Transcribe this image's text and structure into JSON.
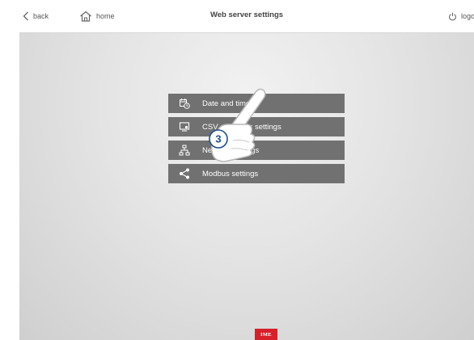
{
  "header": {
    "back_label": "back",
    "home_label": "home",
    "title": "Web server settings",
    "logout_label": "logo"
  },
  "menu": {
    "items": [
      {
        "label": "Date and time",
        "icon": "calendar-clock-icon"
      },
      {
        "label": "CSV and other settings",
        "icon": "monitor-settings-icon"
      },
      {
        "label": "Network settings",
        "icon": "network-icon"
      },
      {
        "label": "Modbus settings",
        "icon": "share-icon"
      }
    ]
  },
  "annotation": {
    "step": "3"
  },
  "footer": {
    "logo_text": "IME",
    "logo_color": "#d8202a"
  },
  "colors": {
    "menu_bg": "#717171",
    "accent": "#1d4f91"
  }
}
